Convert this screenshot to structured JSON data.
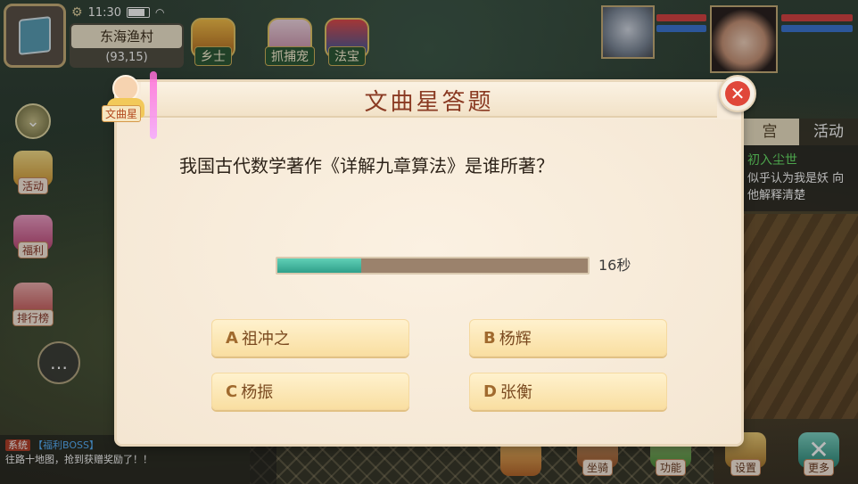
{
  "status_bar": {
    "time": "11:30",
    "battery_level": 0.8
  },
  "location": {
    "name": "东海渔村",
    "coords": "(93,15)"
  },
  "top_icons": [
    {
      "label": "乡士",
      "icon": "ancestor-icon"
    },
    {
      "label": "抓捕宠",
      "icon": "pet-cat-icon"
    },
    {
      "label": "法宝",
      "icon": "treasure-icon"
    }
  ],
  "left_buttons": [
    {
      "label": "活动",
      "icon": "horn-icon"
    },
    {
      "label": "福利",
      "icon": "gift-icon"
    },
    {
      "label": "排行榜",
      "icon": "ranking-icon"
    }
  ],
  "right_panel": {
    "tabs": [
      "宫",
      "活动"
    ],
    "quest_title": "初入尘世",
    "quest_text": "似乎认为我是妖 向他解释清楚"
  },
  "chat_log": {
    "system_tag": "系统",
    "channel": "【福利BOSS】",
    "message": "往路十地图，抢到获赠奖励了！！"
  },
  "bottom_buttons": [
    {
      "label": "",
      "icon": "shop-icon"
    },
    {
      "label": "坐骑",
      "icon": "mount-icon"
    },
    {
      "label": "功能",
      "icon": "function-icon"
    },
    {
      "label": "设置",
      "icon": "settings-icon"
    },
    {
      "label": "更多",
      "icon": "more-x-icon"
    }
  ],
  "npc": {
    "name": "文曲星"
  },
  "quiz": {
    "title": "文曲星答题",
    "question": "我国古代数学著作《详解九章算法》是谁所著？",
    "timer_text": "16秒",
    "timer_progress": 0.27,
    "options": [
      {
        "letter": "A",
        "text": "祖冲之"
      },
      {
        "letter": "B",
        "text": "杨辉"
      },
      {
        "letter": "C",
        "text": "杨振"
      },
      {
        "letter": "D",
        "text": "张衡"
      }
    ]
  },
  "colors": {
    "dialog_bg": "#f7ebda",
    "title_color": "#8a3a22",
    "timer_fill": "#2f9f8a",
    "answer_bg": "#f9dea0",
    "close_red": "#e0473a"
  }
}
